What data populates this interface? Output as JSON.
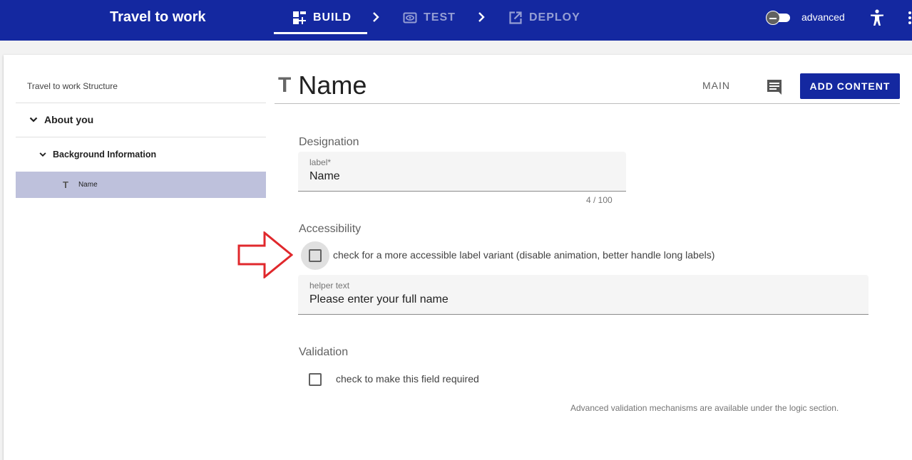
{
  "app": {
    "title": "Travel to work",
    "steps": [
      {
        "label": "BUILD",
        "icon": "build-icon",
        "active": true
      },
      {
        "label": "TEST",
        "icon": "eye-icon",
        "active": false
      },
      {
        "label": "DEPLOY",
        "icon": "open-external-icon",
        "active": false
      }
    ],
    "advanced_label": "advanced",
    "colors": {
      "primary": "#1428a0",
      "selected_row": "#bec1dc",
      "arrow": "#e0282c"
    }
  },
  "sidebar": {
    "title": "Travel to work Structure",
    "items": [
      {
        "label": "About you",
        "icon": "chevron-down-icon"
      },
      {
        "label": "Background Information",
        "icon": "chevron-down-icon"
      },
      {
        "label": "Name",
        "icon": "text-type-icon",
        "selected": true
      }
    ]
  },
  "content": {
    "title": "Name",
    "main_label": "MAIN",
    "add_content_label": "ADD CONTENT",
    "designation": {
      "heading": "Designation",
      "label_field": {
        "label": "label*",
        "value": "Name",
        "counter": "4 / 100"
      }
    },
    "accessibility": {
      "heading": "Accessibility",
      "checkbox_label": "check for a more accessible label variant (disable animation, better handle long labels)",
      "checked": false,
      "helper_field": {
        "label": "helper text",
        "value": "Please enter your full name"
      }
    },
    "validation": {
      "heading": "Validation",
      "required_label": "check to make this field required",
      "checked": false,
      "hint": "Advanced validation mechanisms are available under the logic section."
    }
  }
}
